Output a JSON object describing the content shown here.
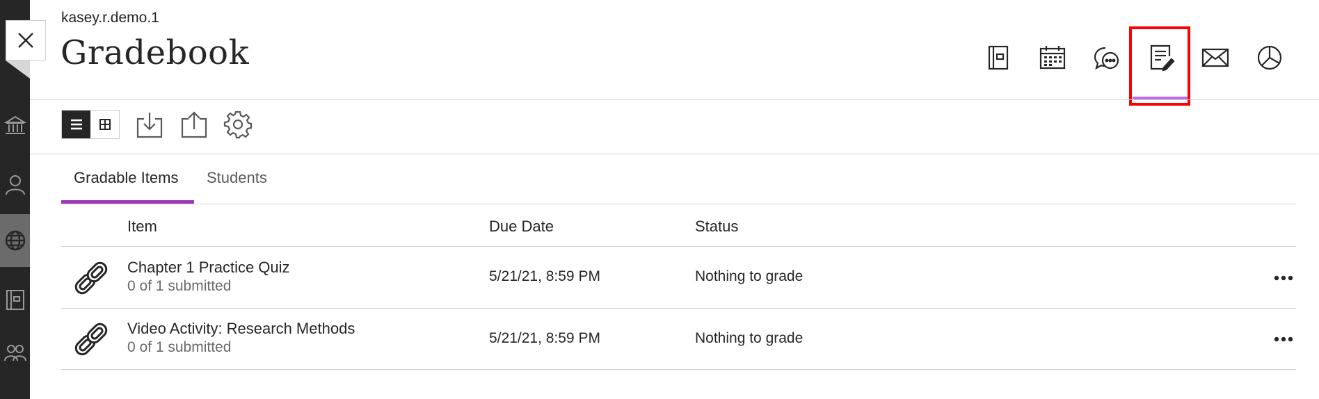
{
  "header": {
    "course_name": "kasey.r.demo.1",
    "page_title": "Gradebook",
    "icons": [
      {
        "name": "content-icon"
      },
      {
        "name": "calendar-icon"
      },
      {
        "name": "discussions-icon"
      },
      {
        "name": "gradebook-icon",
        "selected": true
      },
      {
        "name": "messages-icon"
      },
      {
        "name": "analytics-icon"
      }
    ]
  },
  "toolbar": {
    "view_options": [
      "list-view",
      "grid-view"
    ],
    "selected_view": "list-view",
    "tools": [
      "download-icon",
      "upload-icon",
      "settings-icon"
    ]
  },
  "tabs": [
    {
      "label": "Gradable Items",
      "active": true
    },
    {
      "label": "Students",
      "active": false
    }
  ],
  "table": {
    "columns": [
      "Item",
      "Due Date",
      "Status"
    ],
    "rows": [
      {
        "icon": "link-icon",
        "title": "Chapter 1 Practice Quiz",
        "subtitle": "0 of 1 submitted",
        "due": "5/21/21, 8:59 PM",
        "status": "Nothing to grade"
      },
      {
        "icon": "link-icon",
        "title": "Video Activity: Research Methods",
        "subtitle": "0 of 1 submitted",
        "due": "5/21/21, 8:59 PM",
        "status": "Nothing to grade"
      }
    ]
  },
  "colors": {
    "accent": "#9d38b8",
    "accent_light": "#c36be0",
    "highlight": "#ff0000",
    "nav_bg": "#262626"
  }
}
